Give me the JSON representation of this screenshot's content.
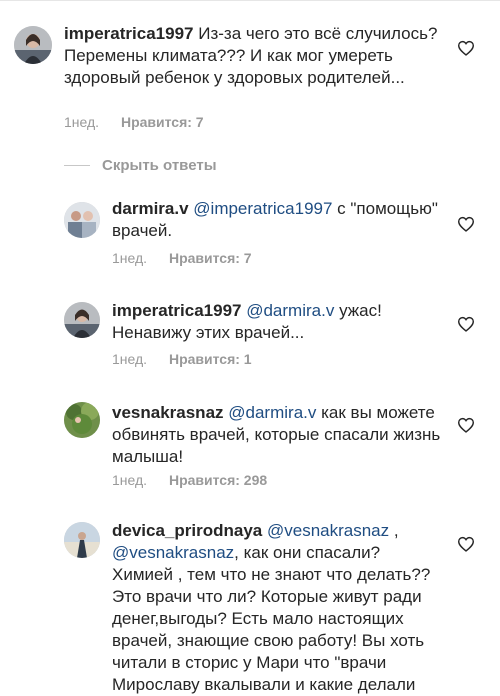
{
  "comments": [
    {
      "username": "imperatrica1997",
      "mention": "",
      "text": "Из-за чего это всё случилось? Перемены климата??? И как мог умереть здоровый ребенок у здоровых родителей...",
      "time": "1нед.",
      "likes": "Нравится: 7"
    },
    {
      "username": "darmira.v",
      "mention": "@imperatrica1997",
      "text": "с \"помощью\" врачей.",
      "time": "1нед.",
      "likes": "Нравится: 7"
    },
    {
      "username": "imperatrica1997",
      "mention": "@darmira.v",
      "text": "ужас! Ненавижу этих врачей...",
      "time": "1нед.",
      "likes": "Нравится: 1"
    },
    {
      "username": "vesnakrasnaz",
      "mention": "@darmira.v",
      "text": "как вы можете обвинять врачей, которые спасали жизнь малыша!",
      "time": "1нед.",
      "likes": "Нравится: 298"
    },
    {
      "username": "devica_prirodnaya",
      "mention": "@vesnakrasnaz",
      "mention2": "@vesnakrasnaz",
      "text_a": ",",
      "text_b": ", как они спасали? Химией , тем что не знают что делать?? Это врачи что ли? Которые живут ради денег,выгоды? Есть мало настоящих врачей, знающие свою работу! Вы хоть читали в сторис у Мари что \"врачи Мирославу вкалывали и какие делали"
    }
  ],
  "hide_replies": "Скрыть ответы",
  "icons": {
    "like": "heart-outline-icon"
  },
  "colors": {
    "mention": "#1f4d82",
    "meta": "#999999",
    "text": "#262626"
  }
}
